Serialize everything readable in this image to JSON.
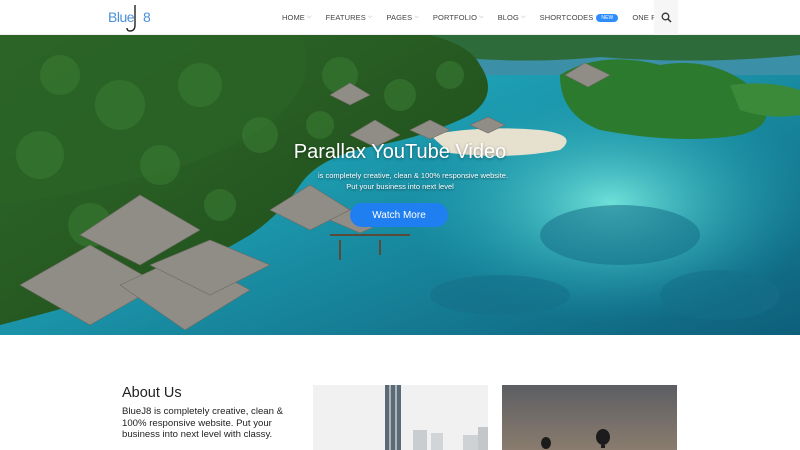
{
  "logo": {
    "text": "BlueJ8",
    "part1": "Blue",
    "part2": "8"
  },
  "nav": {
    "items": [
      {
        "label": "HOME",
        "dropdown": true
      },
      {
        "label": "FEATURES",
        "dropdown": true
      },
      {
        "label": "PAGES",
        "dropdown": true
      },
      {
        "label": "PORTFOLIO",
        "dropdown": true
      },
      {
        "label": "BLOG",
        "dropdown": true
      },
      {
        "label": "SHORTCODES",
        "dropdown": false,
        "badge": "NEW"
      },
      {
        "label": "ONE PAGE",
        "dropdown": false
      }
    ],
    "search_icon": "search-icon"
  },
  "hero": {
    "title": "Parallax YouTube Video",
    "subtitle_line1": "is completely creative, clean & 100% responsive website.",
    "subtitle_line2": "Put your business into next level",
    "button": "Watch More"
  },
  "about": {
    "title": "About Us",
    "text": "BlueJ8 is completely creative, clean & 100% responsive website. Put your business into next level with classy."
  },
  "colors": {
    "accent": "#1f7ff0",
    "logo": "#4a90d9",
    "badge": "#2d8cff"
  }
}
